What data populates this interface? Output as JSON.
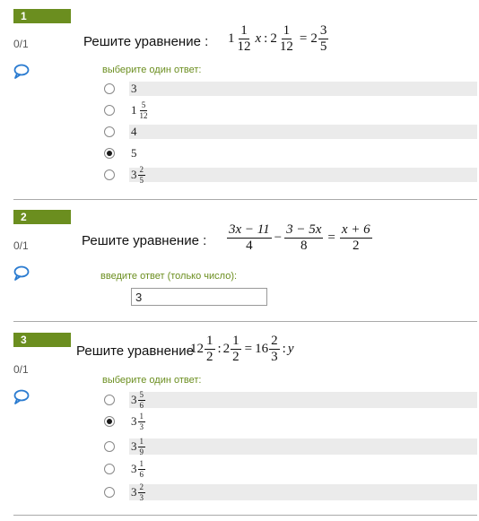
{
  "questions": [
    {
      "number": "1",
      "score": "0/1",
      "prompt": "Решите уравнение :",
      "hint": "выберите один ответ:",
      "equation": {
        "w1": "1",
        "n1": "1",
        "d1": "12",
        "var": "x",
        "colon": ":",
        "w2": "2",
        "n2": "1",
        "d2": "12",
        "eq": "=",
        "w3": "2",
        "n3": "3",
        "d3": "5"
      },
      "options": [
        {
          "whole": "3",
          "num": "",
          "den": "",
          "selected": false
        },
        {
          "whole": "1",
          "num": "5",
          "den": "12",
          "selected": false
        },
        {
          "whole": "4",
          "num": "",
          "den": "",
          "selected": false
        },
        {
          "whole": "5",
          "num": "",
          "den": "",
          "selected": true
        },
        {
          "whole": "3",
          "num": "2",
          "den": "5",
          "selected": false
        }
      ]
    },
    {
      "number": "2",
      "score": "0/1",
      "prompt": "Решите уравнение :",
      "hint": "введите ответ (только число):",
      "equation": {
        "n1": "3x − 11",
        "d1": "4",
        "minus": "−",
        "n2": "3 − 5x",
        "d2": "8",
        "eq": "=",
        "n3": "x + 6",
        "d3": "2"
      },
      "answer_value": "3"
    },
    {
      "number": "3",
      "score": "0/1",
      "prompt": "Решите уравнение",
      "hint": "выберите один ответ:",
      "equation": {
        "w1": "12",
        "n1": "1",
        "d1": "2",
        "colon1": ":",
        "w2": "2",
        "n2": "1",
        "d2": "2",
        "eq": "=",
        "w3": "16",
        "n3": "2",
        "d3": "3",
        "colon2": ":",
        "var": "y"
      },
      "options": [
        {
          "whole": "3",
          "num": "5",
          "den": "6",
          "selected": false
        },
        {
          "whole": "3",
          "num": "1",
          "den": "3",
          "selected": true
        },
        {
          "whole": "3",
          "num": "1",
          "den": "9",
          "selected": false
        },
        {
          "whole": "3",
          "num": "1",
          "den": "6",
          "selected": false
        },
        {
          "whole": "3",
          "num": "2",
          "den": "3",
          "selected": false
        }
      ]
    }
  ]
}
